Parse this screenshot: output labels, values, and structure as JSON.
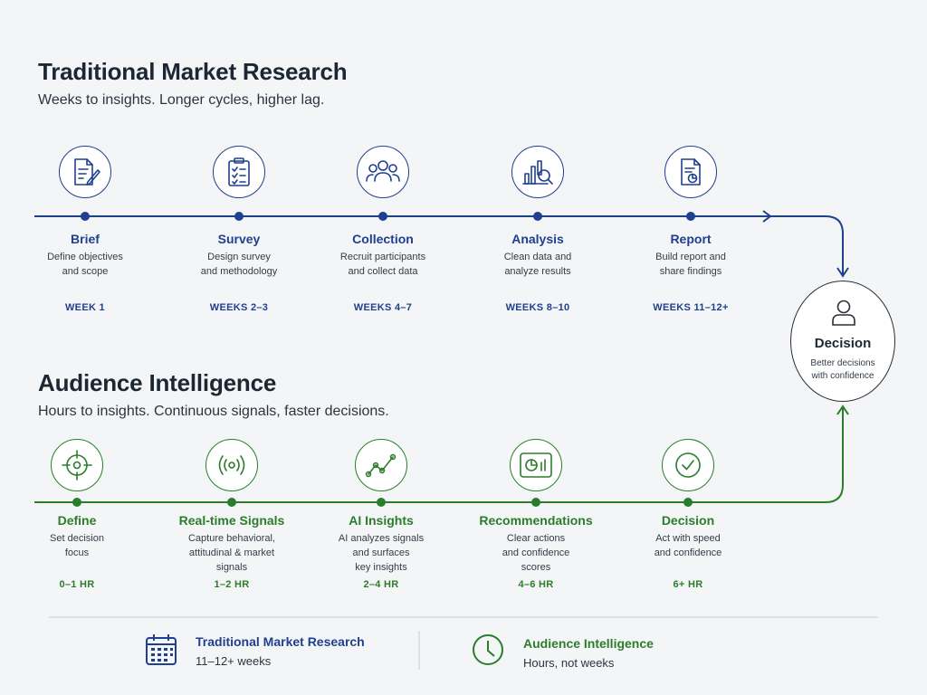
{
  "traditional": {
    "title": "Traditional Market Research",
    "subtitle": "Weeks to insights. Longer cycles, higher lag.",
    "steps": [
      {
        "name": "Brief",
        "desc": [
          "Define objectives",
          "and scope"
        ],
        "time": "WEEK 1",
        "icon": "document-pen-icon"
      },
      {
        "name": "Survey",
        "desc": [
          "Design survey",
          "and methodology"
        ],
        "time": "WEEKS 2–3",
        "icon": "clipboard-checklist-icon"
      },
      {
        "name": "Collection",
        "desc": [
          "Recruit participants",
          "and collect data"
        ],
        "time": "WEEKS 4–7",
        "icon": "people-group-icon"
      },
      {
        "name": "Analysis",
        "desc": [
          "Clean data and",
          "analyze results"
        ],
        "time": "WEEKS 8–10",
        "icon": "chart-magnifier-icon"
      },
      {
        "name": "Report",
        "desc": [
          "Build report and",
          "share findings"
        ],
        "time": "WEEKS 11–12+",
        "icon": "report-pie-icon"
      }
    ]
  },
  "audience": {
    "title": "Audience Intelligence",
    "subtitle": "Hours to insights. Continuous signals, faster decisions.",
    "steps": [
      {
        "name": "Define",
        "desc": [
          "Set decision",
          "focus"
        ],
        "time": "0–1 HR",
        "icon": "target-crosshair-icon"
      },
      {
        "name": "Real-time Signals",
        "desc": [
          "Capture behavioral,",
          "attitudinal & market",
          "signals"
        ],
        "time": "1–2 HR",
        "icon": "broadcast-signal-icon"
      },
      {
        "name": "AI Insights",
        "desc": [
          "AI analyzes signals",
          "and surfaces",
          "key insights"
        ],
        "time": "2–4 HR",
        "icon": "trend-line-icon"
      },
      {
        "name": "Recommendations",
        "desc": [
          "Clear actions",
          "and confidence",
          "scores"
        ],
        "time": "4–6 HR",
        "icon": "dashboard-icon"
      },
      {
        "name": "Decision",
        "desc": [
          "Act with speed",
          "and confidence"
        ],
        "time": "6+ HR",
        "icon": "check-circle-icon"
      }
    ]
  },
  "decision": {
    "title": "Decision",
    "desc": [
      "Better decisions",
      "with confidence"
    ],
    "icon": "person-icon"
  },
  "legend": {
    "traditional": {
      "title": "Traditional Market Research",
      "value": "11–12+ weeks",
      "icon": "calendar-icon"
    },
    "audience": {
      "title": "Audience Intelligence",
      "value": "Hours, not weeks",
      "icon": "clock-icon"
    }
  },
  "colors": {
    "blue": "#1f3f8f",
    "green": "#2b7d2b"
  }
}
